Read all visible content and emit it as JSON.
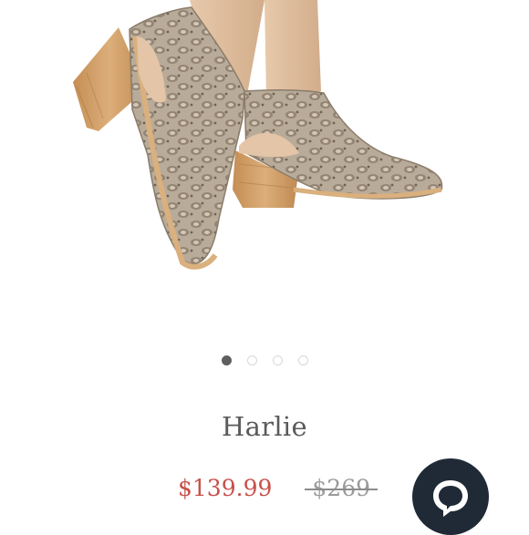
{
  "product": {
    "title": "Harlie",
    "sale_price": "$139.99",
    "original_price": "$269",
    "image_icon": "snakeskin-bootie-photo"
  },
  "carousel": {
    "total_slides": 4,
    "active_index": 0
  },
  "chat": {
    "icon": "chat-bubble-icon"
  },
  "colors": {
    "sale_price": "#c8504a",
    "original_price": "#9a9a9a",
    "title": "#5b5b5b",
    "chat_button": "#1f2a36",
    "dot_active": "#5f5f5f",
    "dot_inactive": "#d7d7d7"
  }
}
